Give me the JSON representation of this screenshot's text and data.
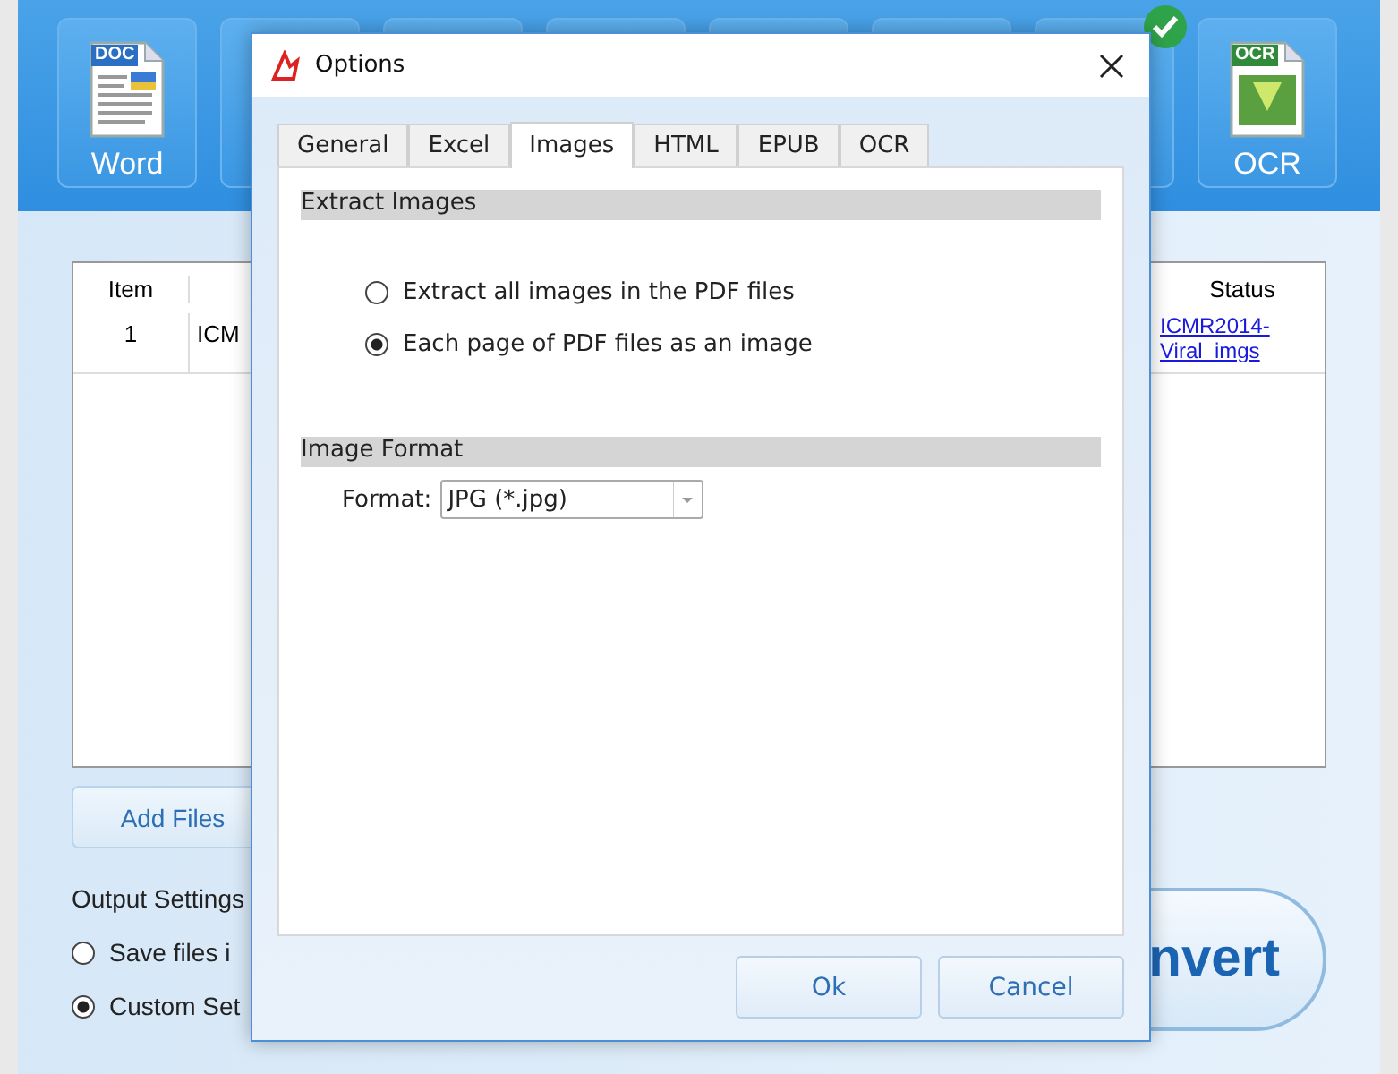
{
  "toolbar": [
    {
      "kind": "doc",
      "tag": "DOC",
      "label": "Word"
    },
    {
      "kind": "blank"
    },
    {
      "kind": "blank"
    },
    {
      "kind": "blank"
    },
    {
      "kind": "blank"
    },
    {
      "kind": "blank"
    },
    {
      "kind": "badged"
    },
    {
      "kind": "ocr",
      "tag": "OCR",
      "label": "OCR"
    }
  ],
  "table": {
    "columns": [
      "Item",
      "Status"
    ],
    "rows": [
      {
        "item": "1",
        "name": "ICM",
        "status": "ICMR2014-Viral_imgs"
      }
    ]
  },
  "add_files": "Add Files",
  "output": {
    "label": "Output Settings",
    "options": [
      {
        "label": "Save files i",
        "selected": false
      },
      {
        "label": "Custom Set",
        "selected": true
      }
    ]
  },
  "convert": "nvert",
  "dialog": {
    "title": "Options",
    "tabs": [
      {
        "label": "General",
        "selected": false
      },
      {
        "label": "Excel",
        "selected": false
      },
      {
        "label": "Images",
        "selected": true
      },
      {
        "label": "HTML",
        "selected": false
      },
      {
        "label": "EPUB",
        "selected": false
      },
      {
        "label": "OCR",
        "selected": false
      }
    ],
    "extract": {
      "title": "Extract Images",
      "options": [
        {
          "label": "Extract all images in the PDF files",
          "selected": false
        },
        {
          "label": "Each page of PDF files as an image",
          "selected": true
        }
      ]
    },
    "format": {
      "title": "Image Format",
      "label": "Format:",
      "value": "JPG (*.jpg)"
    },
    "buttons": [
      "Ok",
      "Cancel"
    ]
  }
}
